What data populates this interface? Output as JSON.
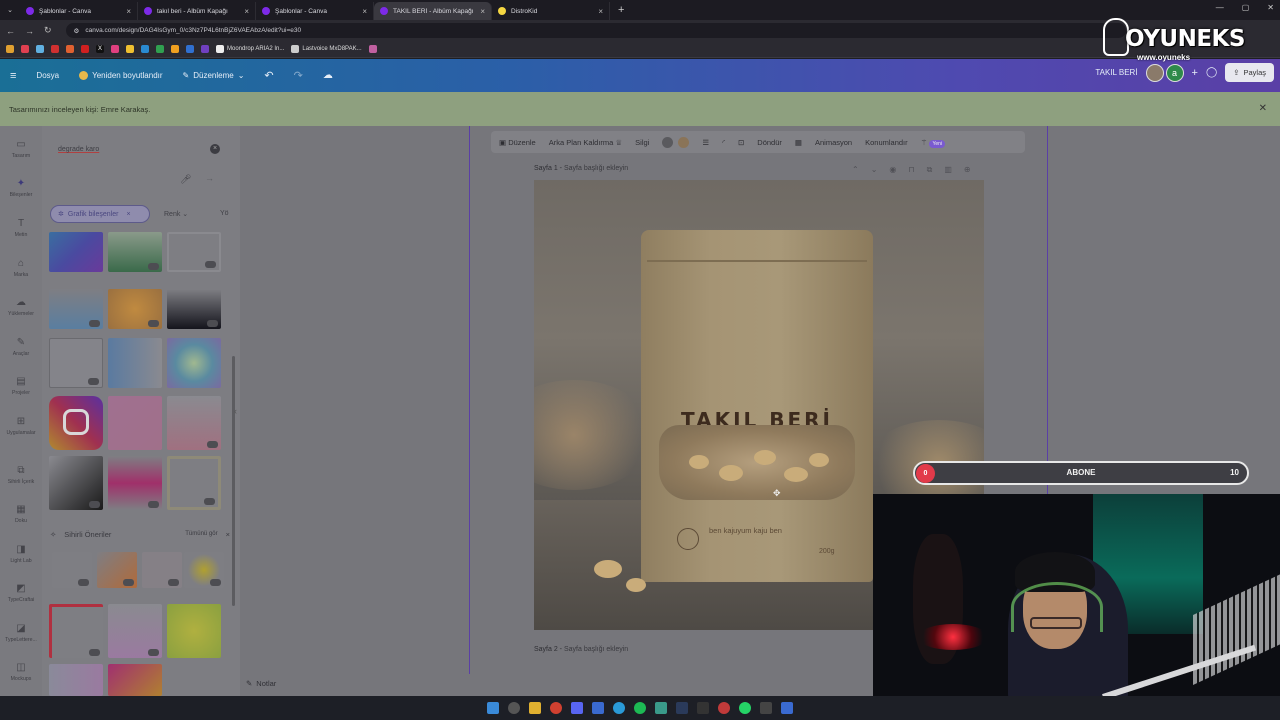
{
  "browser": {
    "tabs": [
      {
        "title": "Şablonlar - Canva",
        "active": false,
        "color": "#7d2ae8"
      },
      {
        "title": "takıl beri - Albüm Kapağı",
        "active": false,
        "color": "#7d2ae8"
      },
      {
        "title": "Şablonlar - Canva",
        "active": false,
        "color": "#7d2ae8"
      },
      {
        "title": "TAKIL BERİ - Albüm Kapağı",
        "active": true,
        "color": "#7d2ae8"
      },
      {
        "title": "DistroKid",
        "active": false,
        "color": "#f5d742"
      }
    ],
    "url": "canva.com/design/DAG4IsGym_0/c3Nz7P4L6tnBjZ6VAEAbzA/edit?ui=e30",
    "bookmarks": [
      "Moondrop ARIA2 In...",
      "Lastvoice MxD8PAK..."
    ]
  },
  "canva_header": {
    "file_menu": "Dosya",
    "resize": "Yeniden boyutlandır",
    "edit_mode": "Düzenleme",
    "design_title": "TAKIL BERİ",
    "avatar_letter": "a",
    "share": "Paylaş"
  },
  "notice": {
    "text": "Tasarımınızı inceleyen kişi: Emre Karakaş."
  },
  "rail": {
    "items": [
      {
        "label": "Tasarım",
        "icon": "layout-icon"
      },
      {
        "label": "Bileşenler",
        "icon": "elements-icon"
      },
      {
        "label": "Metin",
        "icon": "text-icon"
      },
      {
        "label": "Marka",
        "icon": "brand-icon"
      },
      {
        "label": "Yüklemeler",
        "icon": "cloud-upload-icon"
      },
      {
        "label": "Araçlar",
        "icon": "draw-icon"
      },
      {
        "label": "Projeler",
        "icon": "folder-icon"
      },
      {
        "label": "Uygulamalar",
        "icon": "apps-icon"
      },
      {
        "label": "Sihirli İçerik",
        "icon": "magic-media-icon"
      },
      {
        "label": "Doku",
        "icon": "texture-icon"
      },
      {
        "label": "Light Lab",
        "icon": "light-lab-icon"
      },
      {
        "label": "TypeCraftai",
        "icon": "typecraft-icon"
      },
      {
        "label": "TypeLettere...",
        "icon": "typeletter-icon"
      },
      {
        "label": "Mockups",
        "icon": "mockups-icon"
      }
    ]
  },
  "panel": {
    "search_value": "degrade karo",
    "chip_label": "Grafik bileşenler",
    "filter_color": "Renk",
    "filter_more": "Yö",
    "magic_title": "Sihirli Öneriler",
    "magic_see_all": "Tümünü gör",
    "notes": "Notlar"
  },
  "toolbar": {
    "edit": "Düzenle",
    "remove_bg": "Arka Plan Kaldırma",
    "erase": "Silgi",
    "rotate": "Döndür",
    "animation": "Animasyon",
    "position": "Konumlandır",
    "new_badge": "Yeni",
    "swatch_1": "#6b6b6b",
    "swatch_2": "#a08458"
  },
  "pages": {
    "page1_prefix": "Sayfa 1 - ",
    "page1_placeholder": "Sayfa başlığı ekleyin",
    "page2_prefix": "Sayfa 2 - ",
    "page2_placeholder": "Sayfa başlığı ekleyin"
  },
  "design": {
    "bag_title": "TAKIL BERİ",
    "bag_brand": "ben kajuyum kaju ben",
    "bag_weight": "200g"
  },
  "subscribe_bar": {
    "current": "0",
    "label": "ABONE",
    "goal": "10",
    "progress_fraction": 0.0,
    "accent": "#e23a4a"
  },
  "logo": {
    "brand": "OYUNEKS",
    "site": "www.oyuneks"
  }
}
